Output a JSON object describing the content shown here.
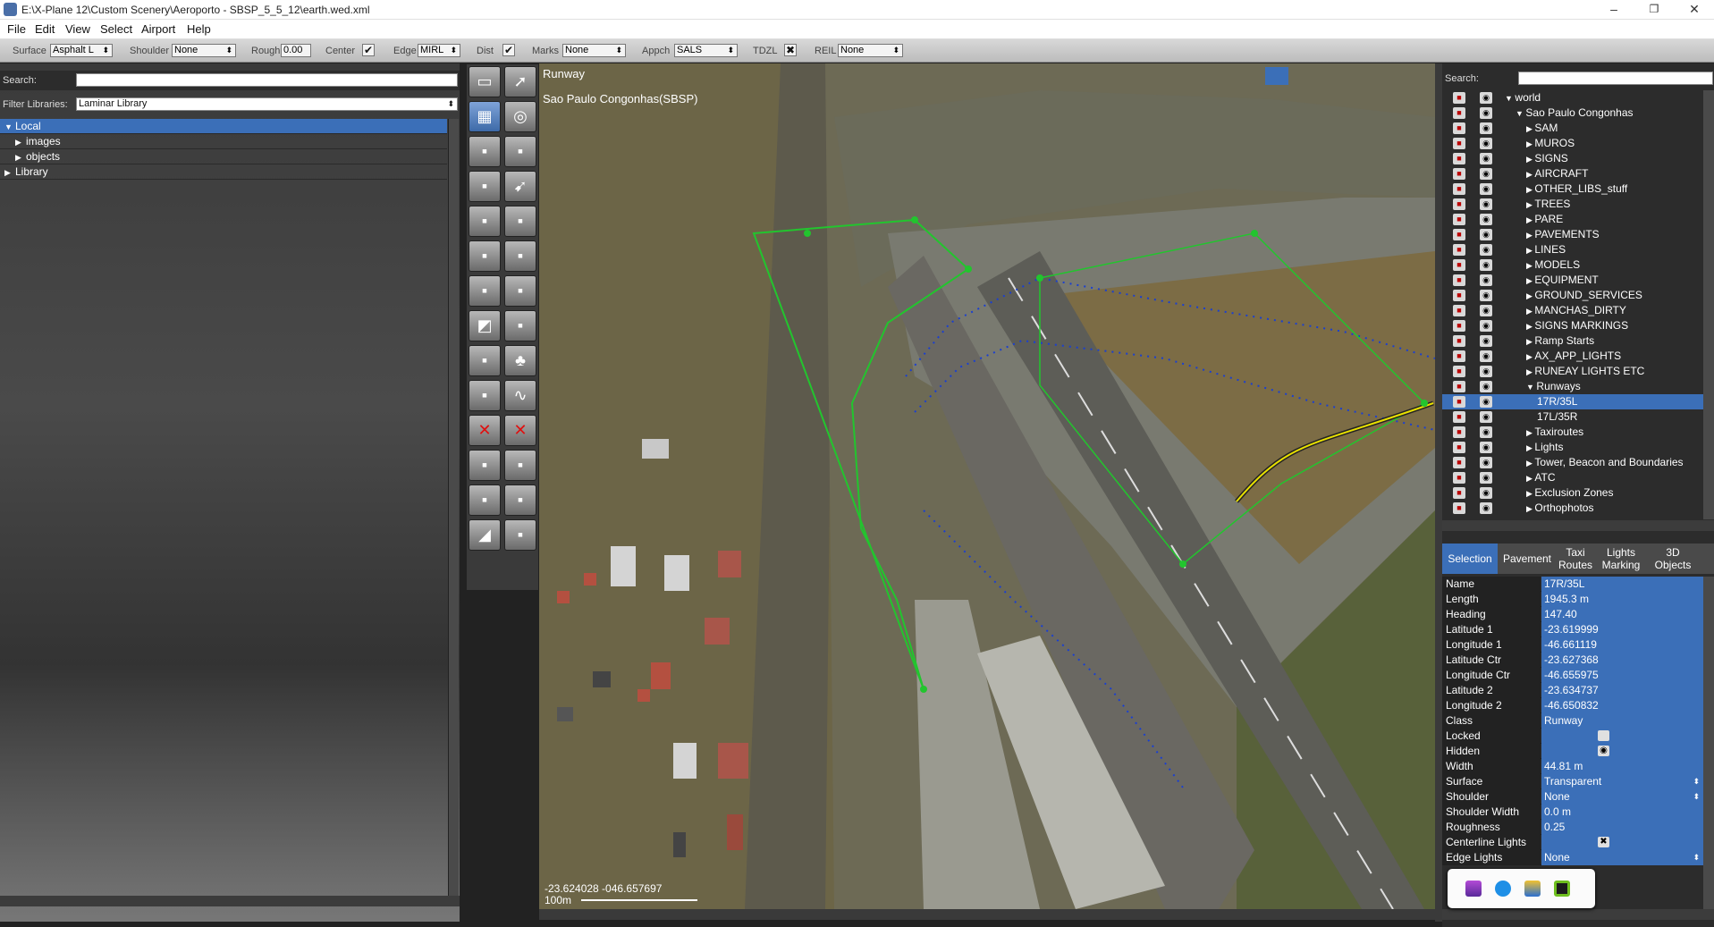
{
  "window": {
    "title": "E:\\X-Plane 12\\Custom Scenery\\Aeroporto - SBSP_5_5_12\\earth.wed.xml",
    "minimize": "–",
    "maximize": "❐",
    "close": "✕"
  },
  "menu": [
    "File",
    "Edit",
    "View",
    "Select",
    "Airport",
    "Help"
  ],
  "toolbar": {
    "surface_label": "Surface",
    "surface_value": "Asphalt L",
    "shoulder_label": "Shoulder",
    "shoulder_value": "None",
    "rough_label": "Rough",
    "rough_value": "0.00",
    "center_label": "Center",
    "edge_label": "Edge",
    "edge_value": "MIRL",
    "dist_label": "Dist",
    "marks_label": "Marks",
    "marks_value": "None",
    "appch_label": "Appch",
    "appch_value": "SALS",
    "tdzl_label": "TDZL",
    "reil_label": "REIL",
    "reil_value": "None"
  },
  "library": {
    "search_label": "Search:",
    "filter_label": "Filter Libraries:",
    "filter_value": "Laminar Library",
    "tree": [
      {
        "label": "Local",
        "indent": 0,
        "expanded": true,
        "selected": true
      },
      {
        "label": "images",
        "indent": 1,
        "expanded": false,
        "selected": false
      },
      {
        "label": "objects",
        "indent": 1,
        "expanded": false,
        "selected": false
      },
      {
        "label": "Library",
        "indent": 0,
        "expanded": false,
        "selected": false
      }
    ]
  },
  "map": {
    "tool_title": "Runway",
    "airport_title": "Sao Paulo Congonhas(SBSP)",
    "coords": "-23.624028 -046.657697",
    "scale_label": "100m"
  },
  "layers": {
    "search_label": "Search:",
    "items": [
      {
        "label": "world",
        "indent": 0,
        "expanded": true
      },
      {
        "label": "Sao Paulo Congonhas",
        "indent": 1,
        "expanded": true
      },
      {
        "label": "SAM",
        "indent": 2,
        "expanded": false
      },
      {
        "label": "MUROS",
        "indent": 2,
        "expanded": false
      },
      {
        "label": "SIGNS",
        "indent": 2,
        "expanded": false
      },
      {
        "label": "AIRCRAFT",
        "indent": 2,
        "expanded": false
      },
      {
        "label": "OTHER_LIBS_stuff",
        "indent": 2,
        "expanded": false
      },
      {
        "label": "TREES",
        "indent": 2,
        "expanded": false
      },
      {
        "label": "PARE",
        "indent": 2,
        "expanded": false
      },
      {
        "label": "PAVEMENTS",
        "indent": 2,
        "expanded": false
      },
      {
        "label": "LINES",
        "indent": 2,
        "expanded": false
      },
      {
        "label": "MODELS",
        "indent": 2,
        "expanded": false
      },
      {
        "label": "EQUIPMENT",
        "indent": 2,
        "expanded": false
      },
      {
        "label": "GROUND_SERVICES",
        "indent": 2,
        "expanded": false
      },
      {
        "label": "MANCHAS_DIRTY",
        "indent": 2,
        "expanded": false
      },
      {
        "label": "SIGNS MARKINGS",
        "indent": 2,
        "expanded": false
      },
      {
        "label": "Ramp Starts",
        "indent": 2,
        "expanded": false
      },
      {
        "label": "AX_APP_LIGHTS",
        "indent": 2,
        "expanded": false
      },
      {
        "label": "RUNEAY LIGHTS ETC",
        "indent": 2,
        "expanded": false
      },
      {
        "label": "Runways",
        "indent": 2,
        "expanded": true
      },
      {
        "label": "17R/35L",
        "indent": 3,
        "leaf": true,
        "selected": true
      },
      {
        "label": "17L/35R",
        "indent": 3,
        "leaf": true
      },
      {
        "label": "Taxiroutes",
        "indent": 2,
        "expanded": false
      },
      {
        "label": "Lights",
        "indent": 2,
        "expanded": false
      },
      {
        "label": "Tower, Beacon and Boundaries",
        "indent": 2,
        "expanded": false
      },
      {
        "label": "ATC",
        "indent": 2,
        "expanded": false
      },
      {
        "label": "Exclusion Zones",
        "indent": 2,
        "expanded": false
      },
      {
        "label": "Orthophotos",
        "indent": 2,
        "expanded": false
      }
    ]
  },
  "tabs": [
    "Selection",
    "Pavement",
    "Taxi Routes",
    "Lights Marking",
    "3D Objects"
  ],
  "properties": [
    {
      "key": "Name",
      "value": "17R/35L"
    },
    {
      "key": "Length",
      "value": "1945.3 m"
    },
    {
      "key": "Heading",
      "value": "147.40"
    },
    {
      "key": "Latitude 1",
      "value": "-23.619999"
    },
    {
      "key": "Longitude 1",
      "value": "-46.661119"
    },
    {
      "key": "Latitude Ctr",
      "value": "-23.627368"
    },
    {
      "key": "Longitude Ctr",
      "value": "-46.655975"
    },
    {
      "key": "Latitude 2",
      "value": "-23.634737"
    },
    {
      "key": "Longitude 2",
      "value": "-46.650832"
    },
    {
      "key": "Class",
      "value": "Runway"
    },
    {
      "key": "Locked",
      "value": ""
    },
    {
      "key": "Hidden",
      "value": ""
    },
    {
      "key": "Width",
      "value": "44.81 m"
    },
    {
      "key": "Surface",
      "value": "Transparent",
      "dropdown": true
    },
    {
      "key": "Shoulder",
      "value": "None",
      "dropdown": true
    },
    {
      "key": "Shoulder Width",
      "value": "0.0 m"
    },
    {
      "key": "Roughness",
      "value": "0.25"
    },
    {
      "key": "Centerline Lights",
      "value": ""
    },
    {
      "key": "Edge Lights",
      "value": "None",
      "dropdown": true
    }
  ],
  "colors": {
    "selection": "#3b6fb8",
    "vertex": "#22c52e",
    "taxi_line": "#1a3fd0"
  }
}
